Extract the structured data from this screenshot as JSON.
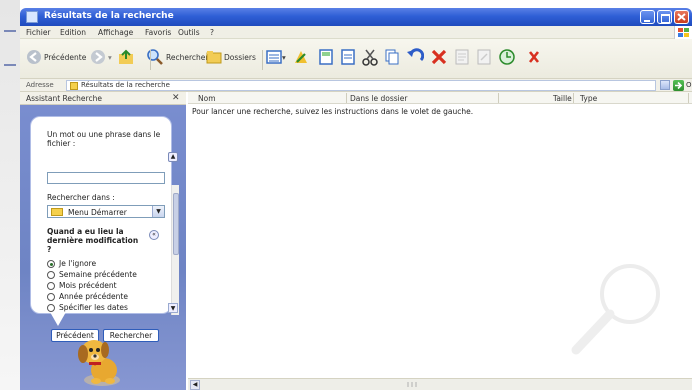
{
  "window": {
    "title": "Résultats de la recherche"
  },
  "menubar": [
    "Fichier",
    "Edition",
    "Affichage",
    "Favoris",
    "Outils",
    "?"
  ],
  "toolbar": {
    "back_label": "Précédente",
    "search_label": "Rechercher",
    "folders_label": "Dossiers"
  },
  "address": {
    "label": "Adresse",
    "value": "Résultats de la recherche",
    "go_label": "OK"
  },
  "search_pane": {
    "title": "Assistant Recherche",
    "phrase_label": "Un mot ou une phrase dans le fichier :",
    "phrase_value": "",
    "lookin_label": "Rechercher dans :",
    "lookin_value": "Menu Démarrer",
    "modified_label": "Quand a eu lieu la dernière modification ?",
    "modified_options": [
      "Je l'ignore",
      "Semaine précédente",
      "Mois précédent",
      "Année précédente",
      "Spécifier les dates"
    ],
    "back_button": "Précédent",
    "search_button": "Rechercher"
  },
  "results": {
    "columns": [
      "Nom",
      "Dans le dossier",
      "Taille",
      "Type"
    ],
    "message": "Pour lancer une recherche, suivez les instructions dans le volet de gauche."
  },
  "colors": {
    "titlebar": "#2f5fd6",
    "pane_bg": "#7a8ed0",
    "close_red": "#c93d1e"
  }
}
